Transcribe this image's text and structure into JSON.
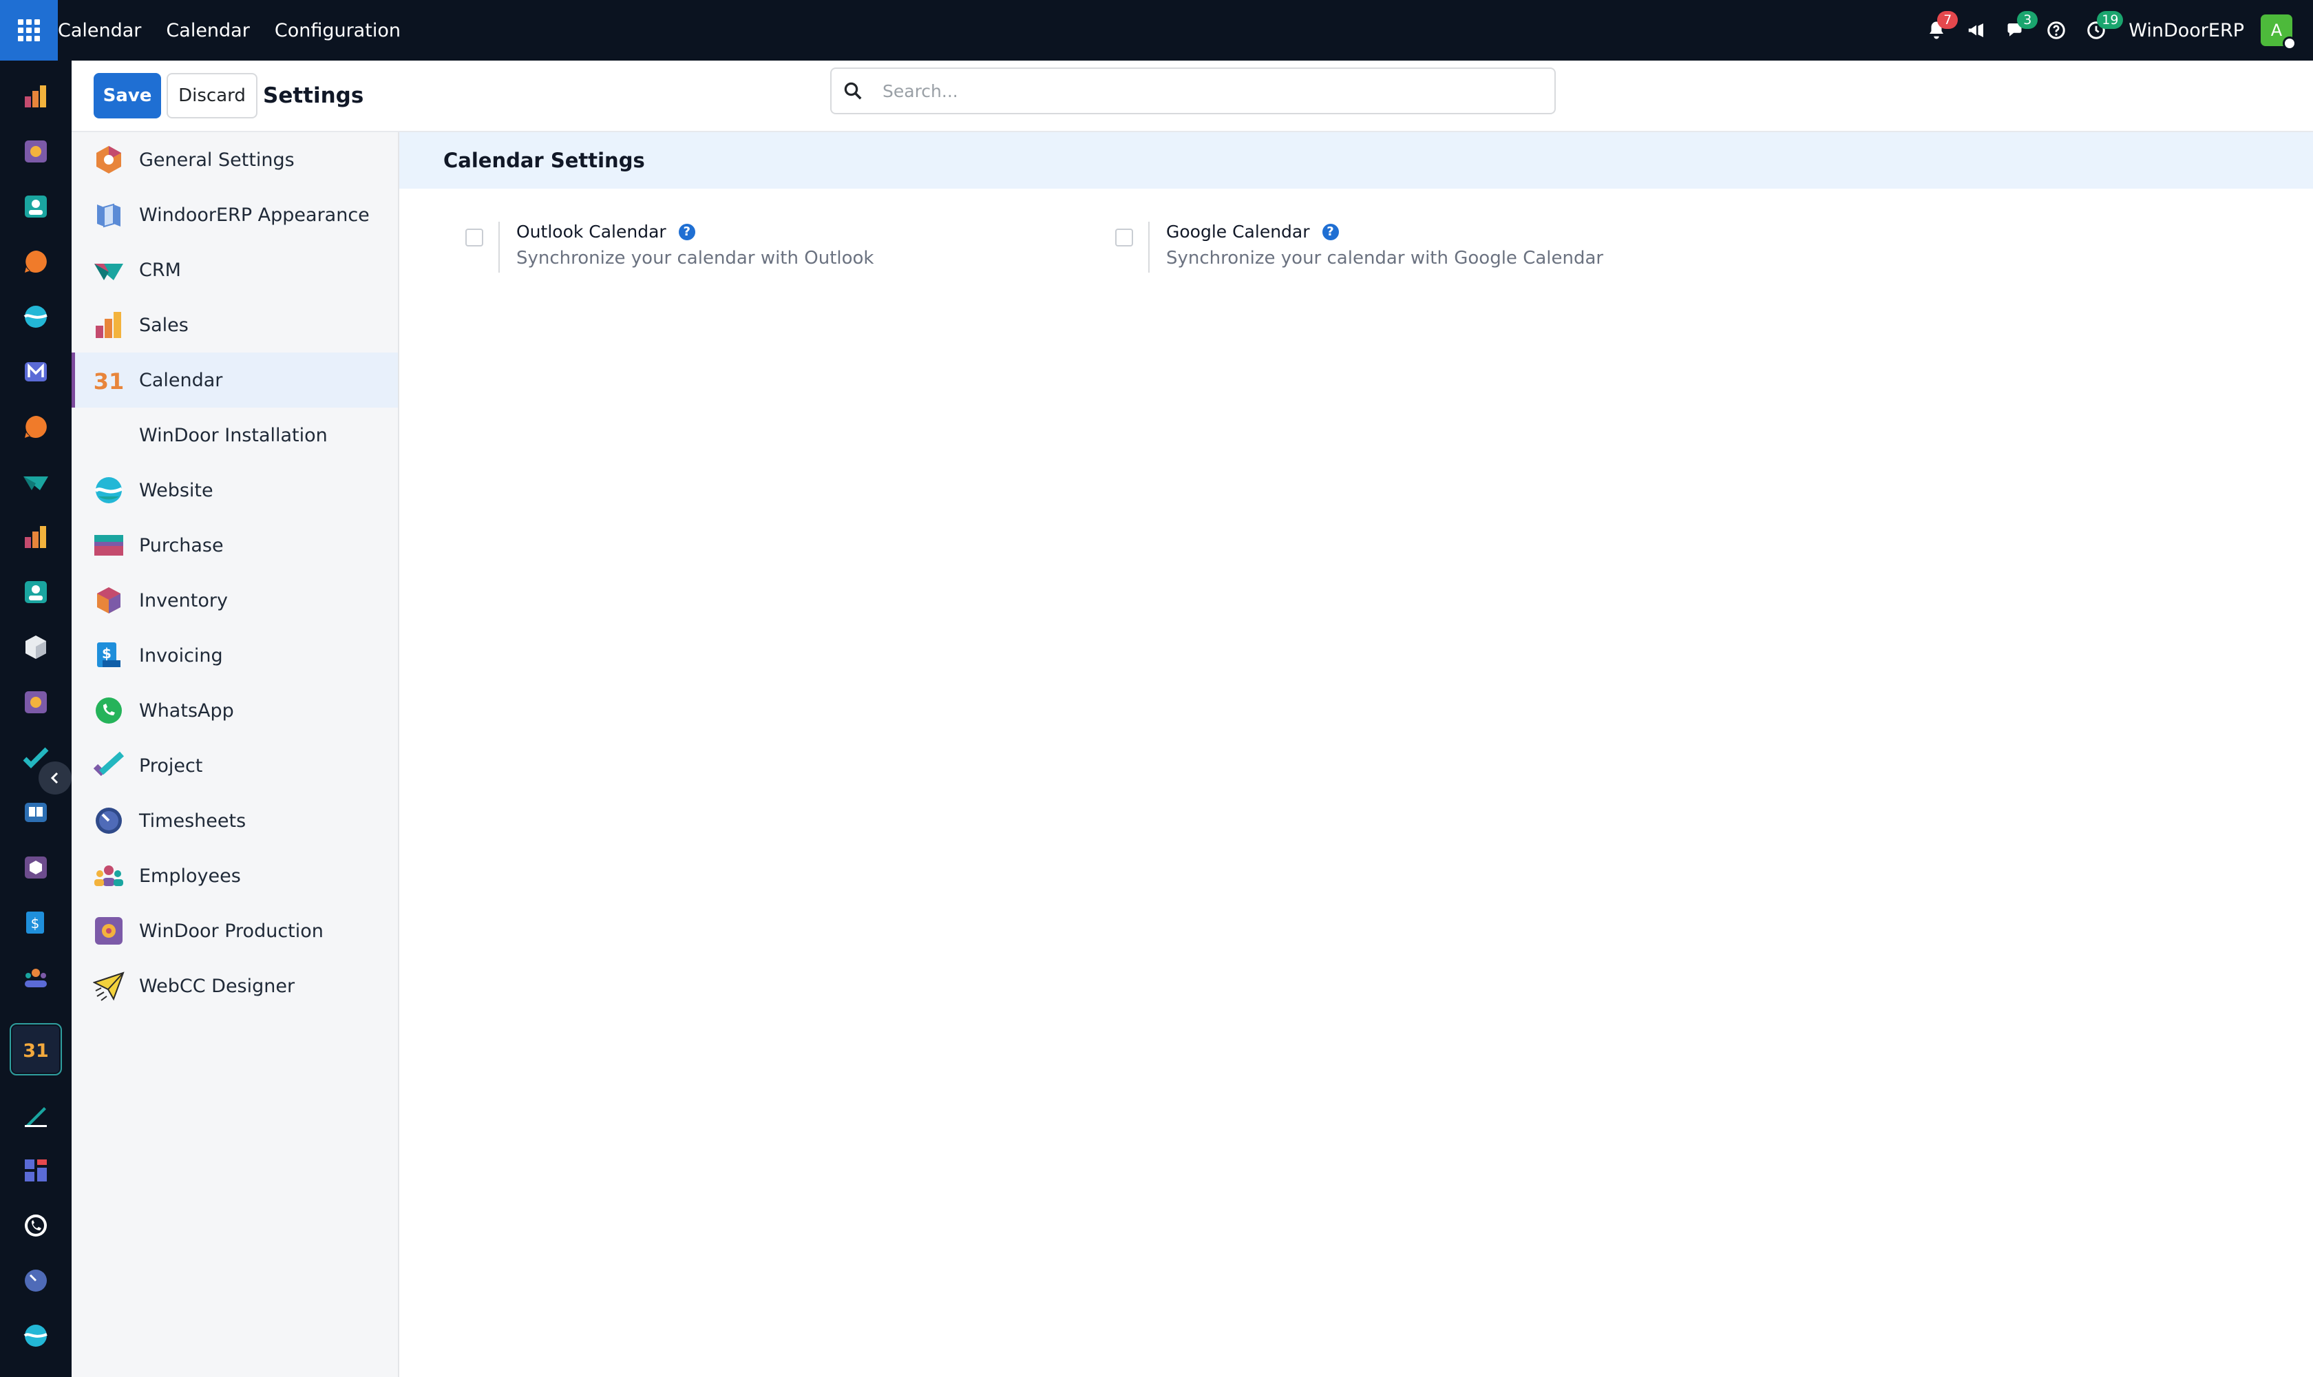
{
  "topbar": {
    "menu": [
      "Calendar",
      "Calendar",
      "Configuration"
    ],
    "company": "WinDoorERP",
    "avatar_letter": "A",
    "badges": {
      "notifications": "7",
      "messages": "3",
      "activities": "19"
    }
  },
  "control_panel": {
    "save_label": "Save",
    "discard_label": "Discard",
    "title": "Settings",
    "search_placeholder": "Search..."
  },
  "sidebar": {
    "items": [
      {
        "label": "General Settings",
        "icon": "general-settings-icon",
        "active": false
      },
      {
        "label": "WindoorERP Appearance",
        "icon": "appearance-icon",
        "active": false
      },
      {
        "label": "CRM",
        "icon": "crm-icon",
        "active": false
      },
      {
        "label": "Sales",
        "icon": "sales-icon",
        "active": false
      },
      {
        "label": "Calendar",
        "icon": "calendar-icon",
        "active": true
      },
      {
        "label": "WinDoor Installation",
        "icon": "",
        "active": false
      },
      {
        "label": "Website",
        "icon": "website-icon",
        "active": false
      },
      {
        "label": "Purchase",
        "icon": "purchase-icon",
        "active": false
      },
      {
        "label": "Inventory",
        "icon": "inventory-icon",
        "active": false
      },
      {
        "label": "Invoicing",
        "icon": "invoicing-icon",
        "active": false
      },
      {
        "label": "WhatsApp",
        "icon": "whatsapp-icon",
        "active": false
      },
      {
        "label": "Project",
        "icon": "project-icon",
        "active": false
      },
      {
        "label": "Timesheets",
        "icon": "timesheets-icon",
        "active": false
      },
      {
        "label": "Employees",
        "icon": "employees-icon",
        "active": false
      },
      {
        "label": "WinDoor Production",
        "icon": "production-icon",
        "active": false
      },
      {
        "label": "WebCC Designer",
        "icon": "designer-icon",
        "active": false
      }
    ]
  },
  "calendar_icon_text": "31",
  "main": {
    "section_title": "Calendar Settings",
    "settings": [
      {
        "label": "Outlook Calendar",
        "description": "Synchronize your calendar with Outlook",
        "checked": false
      },
      {
        "label": "Google Calendar",
        "description": "Synchronize your calendar with Google Calendar",
        "checked": false
      }
    ],
    "help_glyph": "?"
  },
  "colors": {
    "topbar_bg": "#0b1320",
    "primary": "#1f6fd3",
    "active_marker": "#7c4a9c",
    "section_header_bg": "#eaf3fd"
  }
}
